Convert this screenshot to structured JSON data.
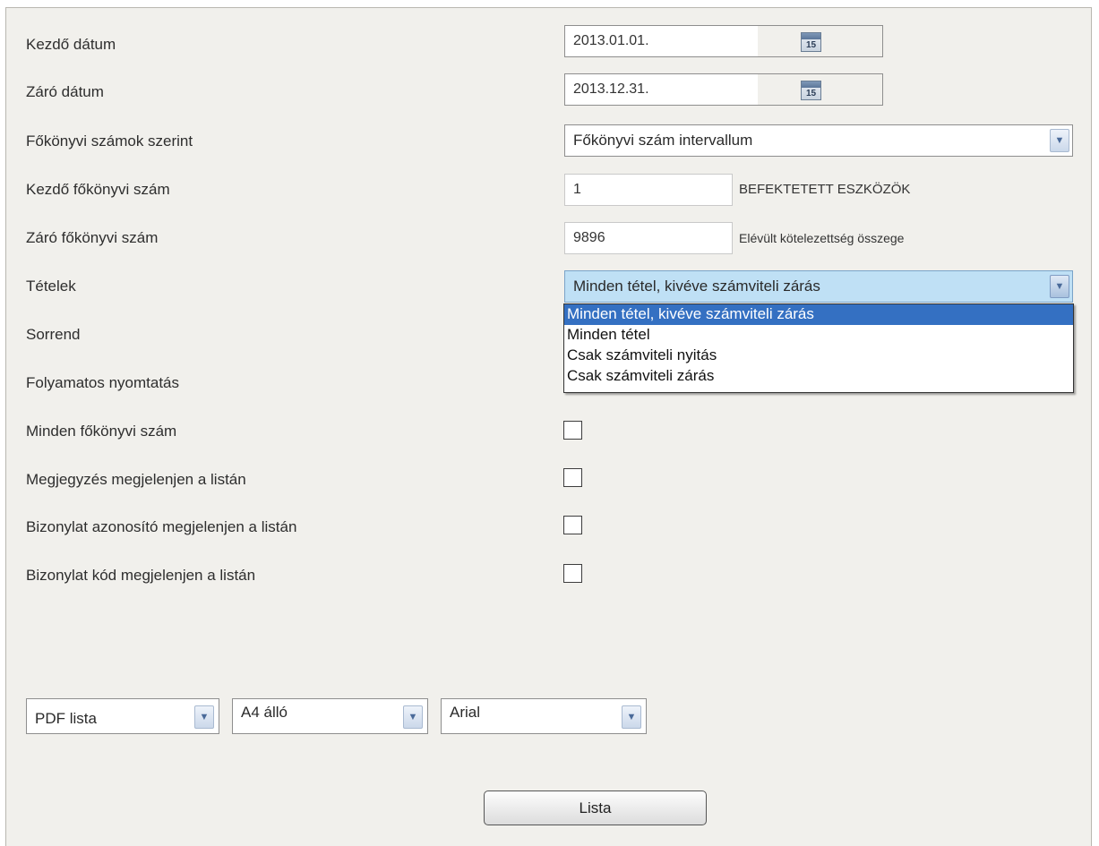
{
  "form": {
    "start_date": {
      "label": "Kezdő dátum",
      "value": "2013.01.01.",
      "calendar_day": "15"
    },
    "end_date": {
      "label": "Záró dátum",
      "value": "2013.12.31.",
      "calendar_day": "15"
    },
    "by_ledger": {
      "label": "Főkönyvi számok szerint",
      "value": "Főkönyvi szám intervallum"
    },
    "start_account": {
      "label": "Kezdő főkönyvi szám",
      "value": "1",
      "description": "BEFEKTETETT ESZKÖZÖK"
    },
    "end_account": {
      "label": "Záró főkönyvi szám",
      "value": "9896",
      "description": "Elévült kötelezettség összege"
    },
    "items": {
      "label": "Tételek",
      "value": "Minden tétel, kivéve számviteli zárás",
      "options": [
        "Minden tétel, kivéve számviteli zárás",
        "Minden tétel",
        "Csak számviteli nyitás",
        "Csak számviteli zárás"
      ]
    },
    "order": {
      "label": "Sorrend"
    },
    "continuous_print": {
      "label": "Folyamatos nyomtatás"
    },
    "all_accounts": {
      "label": "Minden főkönyvi szám",
      "checked": false
    },
    "note_on_list": {
      "label": "Megjegyzés megjelenjen a listán",
      "checked": false
    },
    "doc_id_on_list": {
      "label": "Bizonylat azonosító megjelenjen a listán",
      "checked": false
    },
    "doc_code_on_list": {
      "label": "Bizonylat kód megjelenjen a listán",
      "checked": false
    }
  },
  "output": {
    "format": "PDF lista",
    "paper": "A4 álló",
    "font": "Arial"
  },
  "list_button": "Lista",
  "colors": {
    "panel_bg": "#f1f0ec",
    "selected_option": "#3470c2",
    "active_select": "#bfe0f5"
  }
}
